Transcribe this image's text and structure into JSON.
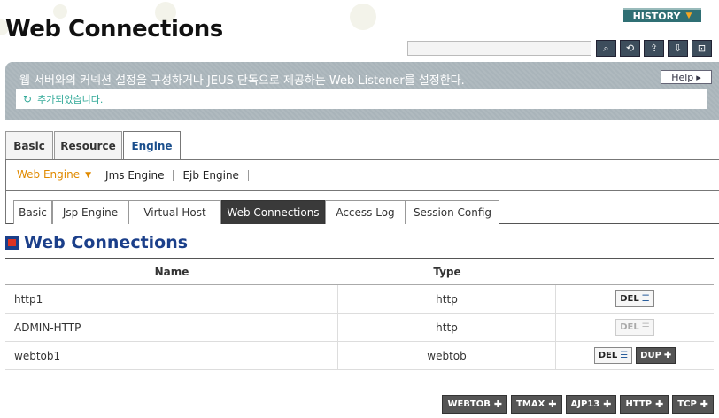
{
  "header": {
    "title": "Web Connections",
    "history_label": "HISTORY",
    "search_placeholder": ""
  },
  "toolbar": {
    "icons": [
      "search-icon",
      "refresh-icon",
      "export-xml-icon",
      "import-xml-icon",
      "lock-icon"
    ]
  },
  "info": {
    "description": "웹 서버와의 커넥션 설정을 구성하거나 JEUS 단독으로 제공하는 Web Listener를 설정한다.",
    "help_label": "Help",
    "status_message": "추가되었습니다."
  },
  "main_tabs": [
    {
      "label": "Basic",
      "active": false
    },
    {
      "label": "Resource",
      "active": false
    },
    {
      "label": "Engine",
      "active": true
    }
  ],
  "engine_nav": [
    {
      "label": "Web Engine",
      "active": true
    },
    {
      "label": "Jms Engine",
      "active": false
    },
    {
      "label": "Ejb Engine",
      "active": false
    }
  ],
  "sub_tabs": [
    {
      "label": "Basic",
      "active": false
    },
    {
      "label": "Jsp Engine",
      "active": false
    },
    {
      "label": "Virtual Host",
      "active": false
    },
    {
      "label": "Web Connections",
      "active": true
    },
    {
      "label": "Access Log",
      "active": false
    },
    {
      "label": "Session Config",
      "active": false
    }
  ],
  "section": {
    "title": "Web Connections"
  },
  "table": {
    "headers": [
      "Name",
      "Type"
    ],
    "rows": [
      {
        "name": "http1",
        "type": "http",
        "del_label": "DEL",
        "del_enabled": true
      },
      {
        "name": "ADMIN-HTTP",
        "type": "http",
        "del_label": "DEL",
        "del_enabled": false
      },
      {
        "name": "webtob1",
        "type": "webtob",
        "del_label": "DEL",
        "del_enabled": true,
        "dup_label": "DUP"
      }
    ]
  },
  "add_buttons": [
    "WEBTOB",
    "TMAX",
    "AJP13",
    "HTTP",
    "TCP"
  ],
  "colors": {
    "accent": "#1b3f8a",
    "active_nav": "#e08a00",
    "status": "#33aa99"
  }
}
